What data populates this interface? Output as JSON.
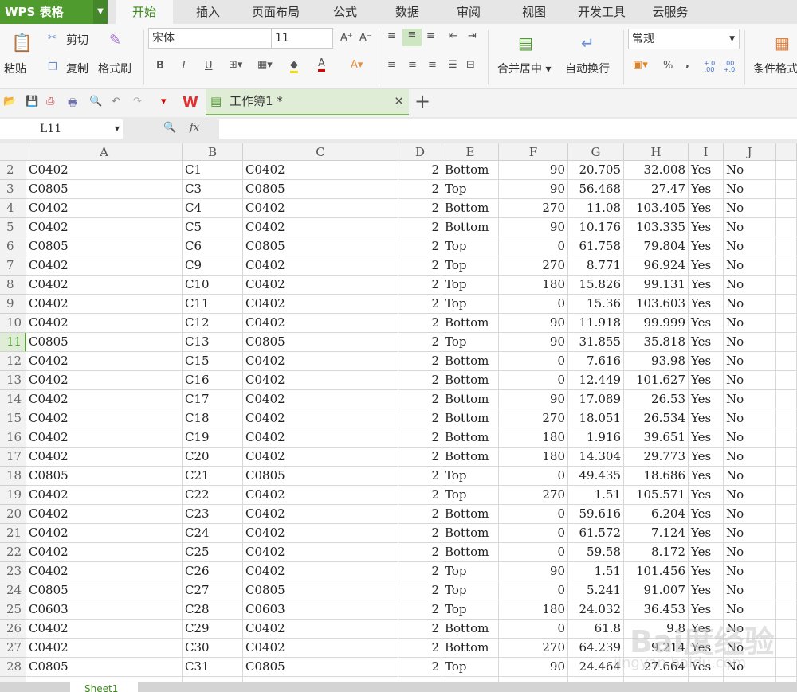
{
  "app": {
    "title": "WPS 表格"
  },
  "menu_tabs": [
    "开始",
    "插入",
    "页面布局",
    "公式",
    "数据",
    "审阅",
    "视图",
    "开发工具",
    "云服务"
  ],
  "ribbon": {
    "paste": "粘贴",
    "cut": "剪切",
    "copy": "复制",
    "format_painter": "格式刷",
    "font_name": "宋体",
    "font_size": "11",
    "bold": "B",
    "italic": "I",
    "underline": "U",
    "merge_center": "合并居中",
    "wrap_text": "自动换行",
    "number_format": "常规",
    "percent": "%",
    "comma": ",",
    "inc_decimal": "+.0 .00",
    "dec_decimal": ".00 +.0",
    "conditional_format": "条件格式"
  },
  "document_tab": {
    "title": "工作簿1 *"
  },
  "formula_bar": {
    "name_box": "L11",
    "fx": "fx",
    "value": ""
  },
  "colors": {
    "accent": "#4f9b2d"
  },
  "grid": {
    "columns": [
      "A",
      "B",
      "C",
      "D",
      "E",
      "F",
      "G",
      "H",
      "I",
      "J"
    ],
    "selected_row": 11,
    "rows": [
      [
        2,
        "C0402",
        "C1",
        "C0402",
        "2",
        "Bottom",
        "90",
        "20.705",
        "32.008",
        "Yes",
        "No"
      ],
      [
        3,
        "C0805",
        "C3",
        "C0805",
        "2",
        "Top",
        "90",
        "56.468",
        "27.47",
        "Yes",
        "No"
      ],
      [
        4,
        "C0402",
        "C4",
        "C0402",
        "2",
        "Bottom",
        "270",
        "11.08",
        "103.405",
        "Yes",
        "No"
      ],
      [
        5,
        "C0402",
        "C5",
        "C0402",
        "2",
        "Bottom",
        "90",
        "10.176",
        "103.335",
        "Yes",
        "No"
      ],
      [
        6,
        "C0805",
        "C6",
        "C0805",
        "2",
        "Top",
        "0",
        "61.758",
        "79.804",
        "Yes",
        "No"
      ],
      [
        7,
        "C0402",
        "C9",
        "C0402",
        "2",
        "Top",
        "270",
        "8.771",
        "96.924",
        "Yes",
        "No"
      ],
      [
        8,
        "C0402",
        "C10",
        "C0402",
        "2",
        "Top",
        "180",
        "15.826",
        "99.131",
        "Yes",
        "No"
      ],
      [
        9,
        "C0402",
        "C11",
        "C0402",
        "2",
        "Top",
        "0",
        "15.36",
        "103.603",
        "Yes",
        "No"
      ],
      [
        10,
        "C0402",
        "C12",
        "C0402",
        "2",
        "Bottom",
        "90",
        "11.918",
        "99.999",
        "Yes",
        "No"
      ],
      [
        11,
        "C0805",
        "C13",
        "C0805",
        "2",
        "Top",
        "90",
        "31.855",
        "35.818",
        "Yes",
        "No"
      ],
      [
        12,
        "C0402",
        "C15",
        "C0402",
        "2",
        "Bottom",
        "0",
        "7.616",
        "93.98",
        "Yes",
        "No"
      ],
      [
        13,
        "C0402",
        "C16",
        "C0402",
        "2",
        "Bottom",
        "0",
        "12.449",
        "101.627",
        "Yes",
        "No"
      ],
      [
        14,
        "C0402",
        "C17",
        "C0402",
        "2",
        "Bottom",
        "90",
        "17.089",
        "26.53",
        "Yes",
        "No"
      ],
      [
        15,
        "C0402",
        "C18",
        "C0402",
        "2",
        "Bottom",
        "270",
        "18.051",
        "26.534",
        "Yes",
        "No"
      ],
      [
        16,
        "C0402",
        "C19",
        "C0402",
        "2",
        "Bottom",
        "180",
        "1.916",
        "39.651",
        "Yes",
        "No"
      ],
      [
        17,
        "C0402",
        "C20",
        "C0402",
        "2",
        "Bottom",
        "180",
        "14.304",
        "29.773",
        "Yes",
        "No"
      ],
      [
        18,
        "C0805",
        "C21",
        "C0805",
        "2",
        "Top",
        "0",
        "49.435",
        "18.686",
        "Yes",
        "No"
      ],
      [
        19,
        "C0402",
        "C22",
        "C0402",
        "2",
        "Top",
        "270",
        "1.51",
        "105.571",
        "Yes",
        "No"
      ],
      [
        20,
        "C0402",
        "C23",
        "C0402",
        "2",
        "Bottom",
        "0",
        "59.616",
        "6.204",
        "Yes",
        "No"
      ],
      [
        21,
        "C0402",
        "C24",
        "C0402",
        "2",
        "Bottom",
        "0",
        "61.572",
        "7.124",
        "Yes",
        "No"
      ],
      [
        22,
        "C0402",
        "C25",
        "C0402",
        "2",
        "Bottom",
        "0",
        "59.58",
        "8.172",
        "Yes",
        "No"
      ],
      [
        23,
        "C0402",
        "C26",
        "C0402",
        "2",
        "Top",
        "90",
        "1.51",
        "101.456",
        "Yes",
        "No"
      ],
      [
        24,
        "C0805",
        "C27",
        "C0805",
        "2",
        "Top",
        "0",
        "5.241",
        "91.007",
        "Yes",
        "No"
      ],
      [
        25,
        "C0603",
        "C28",
        "C0603",
        "2",
        "Top",
        "180",
        "24.032",
        "36.453",
        "Yes",
        "No"
      ],
      [
        26,
        "C0402",
        "C29",
        "C0402",
        "2",
        "Bottom",
        "0",
        "61.8",
        "9.8",
        "Yes",
        "No"
      ],
      [
        27,
        "C0402",
        "C30",
        "C0402",
        "2",
        "Bottom",
        "270",
        "64.239",
        "9.214",
        "Yes",
        "No"
      ],
      [
        28,
        "C0805",
        "C31",
        "C0805",
        "2",
        "Top",
        "90",
        "24.464",
        "27.664",
        "Yes",
        "No"
      ]
    ]
  },
  "sheet_tabs": [
    "Sheet1"
  ],
  "watermark": {
    "text": "Bai度经验",
    "url_text": "jingyan.baidu.com"
  }
}
